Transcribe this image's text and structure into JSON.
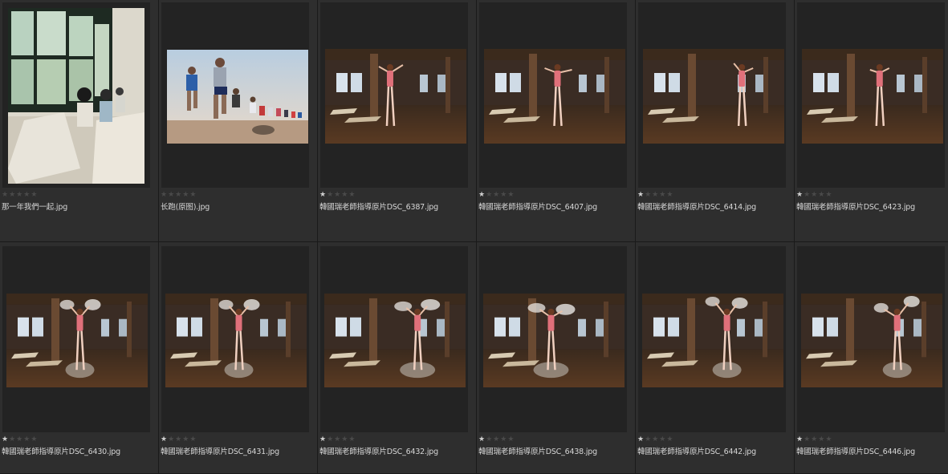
{
  "thumbnails": [
    {
      "filename": "那一年我們一起.jpg",
      "rating": 0
    },
    {
      "filename": "长跑(原图).jpg",
      "rating": 0
    },
    {
      "filename": "韓國瑞老師指導原片DSC_6387.jpg",
      "rating": 1
    },
    {
      "filename": "韓國瑞老師指導原片DSC_6407.jpg",
      "rating": 1
    },
    {
      "filename": "韓國瑞老師指導原片DSC_6414.jpg",
      "rating": 1
    },
    {
      "filename": "韓國瑞老師指導原片DSC_6423.jpg",
      "rating": 1
    },
    {
      "filename": "韓國瑞老師指導原片DSC_6430.jpg",
      "rating": 1
    },
    {
      "filename": "韓國瑞老師指導原片DSC_6431.jpg",
      "rating": 1
    },
    {
      "filename": "韓國瑞老師指導原片DSC_6432.jpg",
      "rating": 1
    },
    {
      "filename": "韓國瑞老師指導原片DSC_6438.jpg",
      "rating": 1
    },
    {
      "filename": "韓國瑞老師指導原片DSC_6442.jpg",
      "rating": 1
    },
    {
      "filename": "韓國瑞老師指導原片DSC_6446.jpg",
      "rating": 1
    }
  ],
  "colors": {
    "background": "#2a2a2a",
    "cell": "#2e2e2e",
    "frame": "#232323",
    "star_on": "#d0d0d0",
    "star_off": "#4a4a4a",
    "text": "#d6d6d6"
  }
}
